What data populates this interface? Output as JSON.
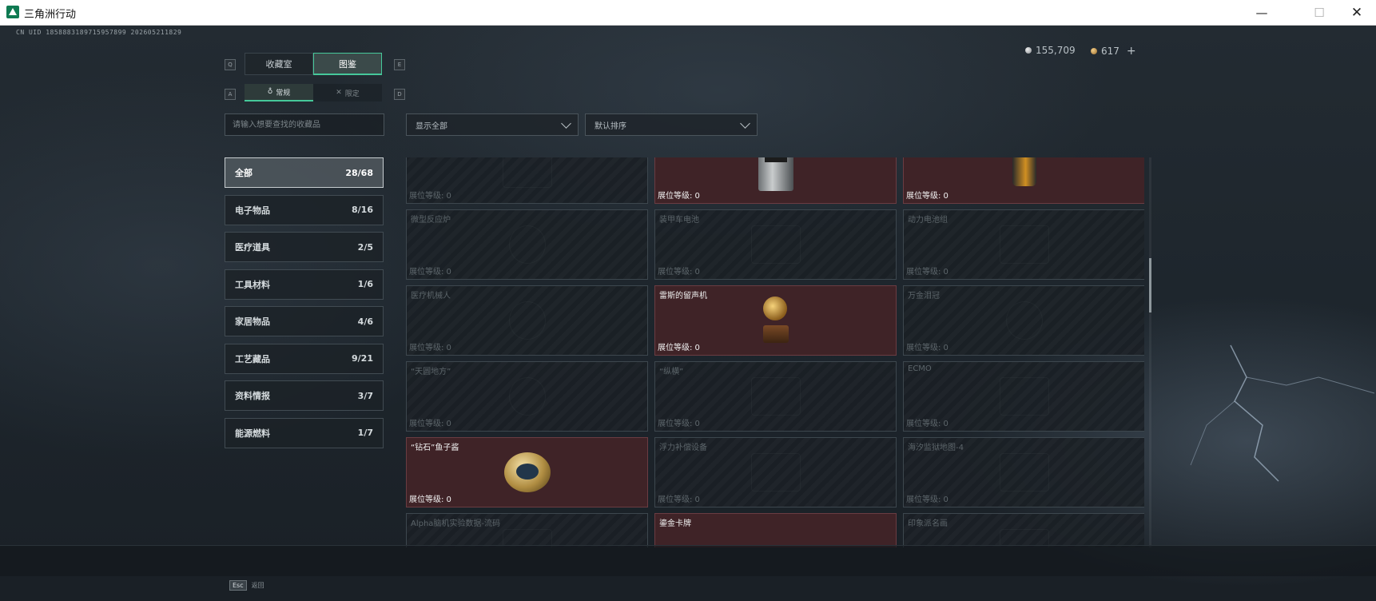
{
  "window": {
    "title": "三角洲行动",
    "min": "—",
    "max": "☐",
    "close": "✕"
  },
  "uid": "CN UID 1858883189715957899 202605211829",
  "currency": {
    "silver": "155,709",
    "gold": "617",
    "plus": "+"
  },
  "key_hints": {
    "q": "Q",
    "e": "E",
    "a": "A",
    "d": "D"
  },
  "tabs": [
    {
      "label": "收藏室"
    },
    {
      "label": "图鉴"
    }
  ],
  "subtabs": [
    {
      "label": "常规",
      "icon": "flame-icon"
    },
    {
      "label": "限定",
      "icon": "crossed-icon"
    }
  ],
  "search": {
    "placeholder": "请输入想要查找的收藏品"
  },
  "filters": {
    "show": "显示全部",
    "sort": "默认排序"
  },
  "categories": [
    {
      "label": "全部",
      "count": "28/68"
    },
    {
      "label": "电子物品",
      "count": "8/16"
    },
    {
      "label": "医疗道具",
      "count": "2/5"
    },
    {
      "label": "工具材料",
      "count": "1/6"
    },
    {
      "label": "家居物品",
      "count": "4/6"
    },
    {
      "label": "工艺藏品",
      "count": "9/21"
    },
    {
      "label": "资料情报",
      "count": "3/7"
    },
    {
      "label": "能源燃料",
      "count": "1/7"
    }
  ],
  "level_label": "展位等级: 0",
  "items": [
    {
      "name": "",
      "owned": false
    },
    {
      "name": "",
      "owned": true
    },
    {
      "name": "",
      "owned": true
    },
    {
      "name": "微型反应炉",
      "owned": false
    },
    {
      "name": "装甲车电池",
      "owned": false
    },
    {
      "name": "动力电池组",
      "owned": false
    },
    {
      "name": "医疗机械人",
      "owned": false
    },
    {
      "name": "雷斯的留声机",
      "owned": true
    },
    {
      "name": "万金泪冠",
      "owned": false
    },
    {
      "name": "“天圆地方”",
      "owned": false
    },
    {
      "name": "“纵横”",
      "owned": false
    },
    {
      "name": "ECMO",
      "owned": false
    },
    {
      "name": "“钻石”鱼子酱",
      "owned": true
    },
    {
      "name": "浮力补偿设备",
      "owned": false
    },
    {
      "name": "海汐监狱地图-4",
      "owned": false
    },
    {
      "name": "Alpha脑机实验数据-流码",
      "owned": false
    },
    {
      "name": "鎏金卡牌",
      "owned": true
    },
    {
      "name": "印象派名画",
      "owned": false
    }
  ],
  "footer": {
    "esc_key": "Esc",
    "esc_label": "返回"
  },
  "colors": {
    "accent": "#46c89a",
    "owned_bg": "#3f2327"
  }
}
